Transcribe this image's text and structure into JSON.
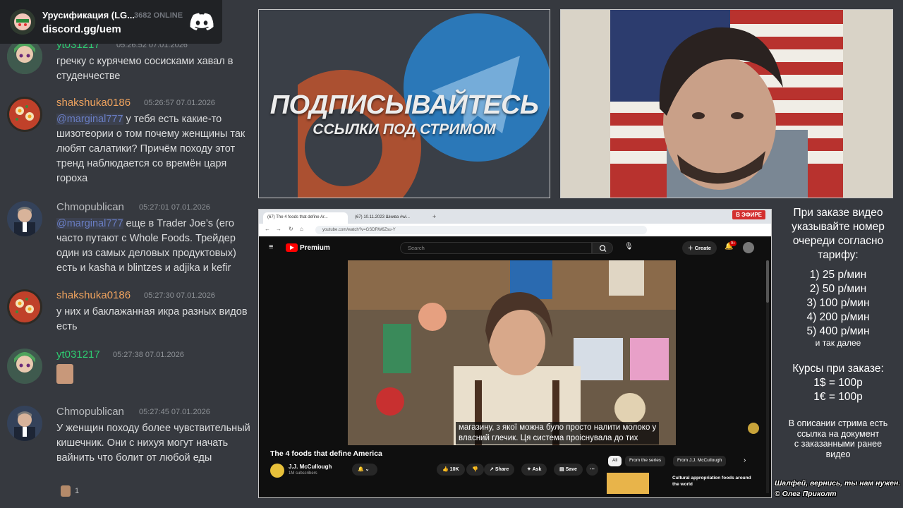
{
  "discord": {
    "server_name": "Урусификация (LG...",
    "online": "3682 ONLINE",
    "invite": "discord.gg/uem"
  },
  "messages": [
    {
      "user": "yt031217",
      "time": "05:26:52 07.01.2026",
      "text": "гречку с курячемо сосисками хавал в студенчестве",
      "color": "green"
    },
    {
      "user": "shakshuka0186",
      "time": "05:26:57 07.01.2026",
      "mention": "@marginal777",
      "text": " у тебя есть какие-то шизотеории о том почему женщины так любят салатики? Причём походу этот тренд наблюдается со времён царя гороха",
      "color": "orange"
    },
    {
      "user": "Chmopublican",
      "time": "05:27:01 07.01.2026",
      "mention": "@marginal777",
      "text": " еще в Trader Joe’s (его часто путают с Whole Foods. Трейдер один из самых деловых продуктовых) есть и kasha и blintzes и adjika и kefir",
      "color": "grey"
    },
    {
      "user": "shakshuka0186",
      "time": "05:27:30 07.01.2026",
      "text": "у них и баклажанная икра разных видов есть",
      "color": "orange"
    },
    {
      "user": "yt031217",
      "time": "05:27:38 07.01.2026",
      "text": "",
      "color": "green"
    },
    {
      "user": "Chmopublican",
      "time": "05:27:45 07.01.2026",
      "text": "У женщин походу более чувствительный кишечник. Они с нихуя могут начать вайнить что болит от любой еды",
      "color": "grey"
    }
  ],
  "reaction": {
    "count": "1"
  },
  "promo": {
    "title": "ПОДПИСЫВАЙТЕСЬ",
    "subtitle": "ССЫЛКИ ПОД СТРИМОМ"
  },
  "browser": {
    "live_badge": "В ЭФИРЕ",
    "tab1": "(67) The 4 foods that define Ar...",
    "tab2": "(67) 10.11.2023 Шнива #wi...",
    "url": "youtube.com/watch?v=GSDRW6Zsu-Y",
    "yt_brand": "Premium",
    "search_placeholder": "Search",
    "create_label": "Create",
    "notif_count": "9+",
    "captions_line1": "магазину, з якої можна було просто налити молоко у",
    "captions_line2": "власний глечик. Ця система проіснувала до тих",
    "video_title": "The 4 foods that define America",
    "channel_name": "J.J. McCullough",
    "subscribers": "1M subscribers",
    "likes": "10K",
    "share": "Share",
    "ask": "Ask",
    "save": "Save",
    "chips": [
      "All",
      "From the series",
      "From J.J. McCullough"
    ],
    "suggested_title": "Cultural appropriation foods around the world"
  },
  "info": {
    "order_text": [
      "При заказе видео",
      "указывайте номер",
      "очереди согласно",
      "тарифу:"
    ],
    "tariffs": [
      "1) 25 р/мин",
      "2) 50 р/мин",
      "3) 100 р/мин",
      "4) 200 р/мин",
      "5) 400 р/мин"
    ],
    "tariffs_more": "и так далее",
    "rates_title": "Курсы при заказе:",
    "rates": [
      "1$ = 100р",
      "1€ = 100р"
    ],
    "desc": [
      "В описании стрима есть",
      "ссылка на документ",
      "с заказанными ранее",
      "видео"
    ],
    "footer_line1": "Шалфей, вернись, ты нам нужен.",
    "footer_line2": "© Олег Приколт"
  }
}
